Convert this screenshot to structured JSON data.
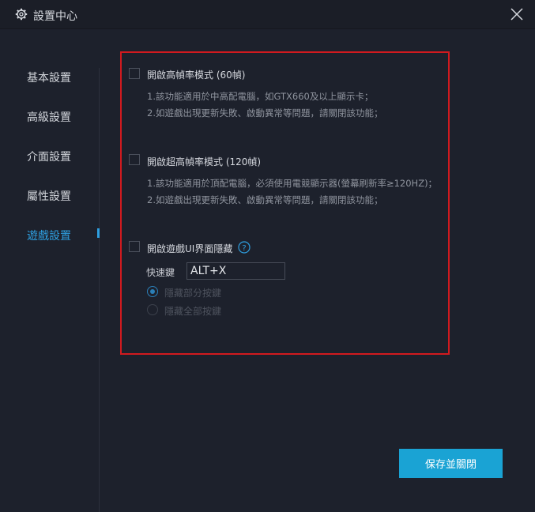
{
  "window": {
    "title": "設置中心"
  },
  "sidebar": {
    "items": [
      {
        "label": "基本設置"
      },
      {
        "label": "高級設置"
      },
      {
        "label": "介面設置"
      },
      {
        "label": "屬性設置"
      },
      {
        "label": "遊戲設置",
        "active": true
      }
    ]
  },
  "options": [
    {
      "label": "開啟高幀率模式 (60幀)",
      "checked": false,
      "desc": [
        "1.該功能適用於中高配電腦，如GTX660及以上顯示卡；",
        "2.如遊戲出現更新失敗、啟動異常等問題，請關閉該功能；"
      ]
    },
    {
      "label": "開啟超高幀率模式 (120幀)",
      "checked": false,
      "desc": [
        "1.該功能適用於頂配電腦，必須使用電競顯示器(螢幕刷新率≥120HZ)；",
        "2.如遊戲出現更新失敗、啟動異常等問題，請關閉該功能；"
      ]
    },
    {
      "label": "開啟遊戲UI界面隱藏",
      "checked": false
    }
  ],
  "hotkey": {
    "label": "快速鍵",
    "value": "ALT+X"
  },
  "hide_mode": {
    "selected": 0,
    "options": [
      {
        "label": "隱藏部分按鍵"
      },
      {
        "label": "隱藏全部按鍵"
      }
    ]
  },
  "actions": {
    "save_label": "保存並關閉"
  },
  "colors": {
    "accent": "#1aa3d4",
    "highlight_box": "#d11a1f",
    "background": "#1d212c"
  },
  "icons": {
    "title": "gear-icon",
    "close": "close-icon",
    "help": "question-mark-icon"
  }
}
